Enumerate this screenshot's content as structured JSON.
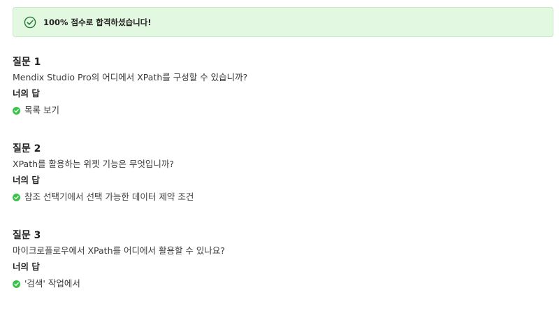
{
  "banner": {
    "icon": "circle-check-icon",
    "message": "100% 점수로 합격하셨습니다!",
    "color_bg": "#e3f8e1",
    "color_icon": "#1f7a33"
  },
  "questions": [
    {
      "title": "질문 1",
      "text": "Mendix Studio Pro의 어디에서 XPath를 구성할 수 있습니까?",
      "answer_label": "너의 답",
      "answer": "목록 보기",
      "answer_icon": "check-circle-icon"
    },
    {
      "title": "질문 2",
      "text": "XPath를 활용하는 위젯 기능은 무엇입니까?",
      "answer_label": "너의 답",
      "answer": "참조 선택기에서 선택 가능한 데이터 제약 조건",
      "answer_icon": "check-circle-icon"
    },
    {
      "title": "질문 3",
      "text": "마이크로플로우에서 XPath를 어디에서 활용할 수 있나요?",
      "answer_label": "너의 답",
      "answer": "'검색' 작업에서",
      "answer_icon": "check-circle-icon"
    }
  ],
  "colors": {
    "check_green": "#3cc24a"
  }
}
